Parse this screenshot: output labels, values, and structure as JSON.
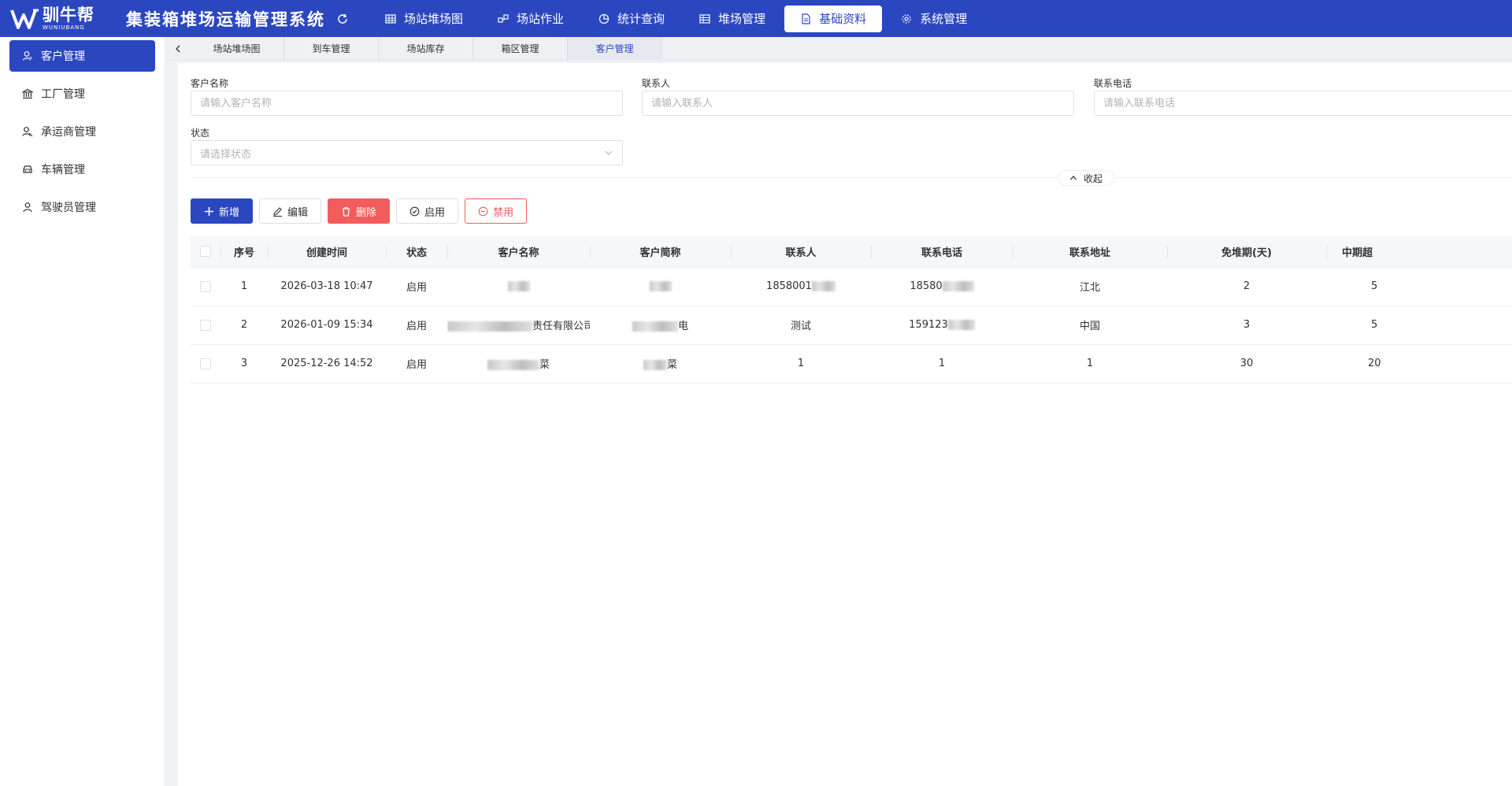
{
  "brand": {
    "logo_cn": "驯牛帮",
    "logo_en": "WUNIUBANG",
    "app_title": "集装箱堆场运输管理系统"
  },
  "nav": [
    {
      "label": "场站堆场图",
      "icon": "grid-icon",
      "active": false
    },
    {
      "label": "场站作业",
      "icon": "workflow-icon",
      "active": false
    },
    {
      "label": "统计查询",
      "icon": "pie-chart-icon",
      "active": false
    },
    {
      "label": "堆场管理",
      "icon": "table-icon",
      "active": false
    },
    {
      "label": "基础资料",
      "icon": "document-icon",
      "active": true
    },
    {
      "label": "系统管理",
      "icon": "gear-icon",
      "active": false
    }
  ],
  "sidebar": {
    "items": [
      {
        "label": "客户管理",
        "icon": "customer-icon",
        "active": true
      },
      {
        "label": "工厂管理",
        "icon": "factory-icon",
        "active": false
      },
      {
        "label": "承运商管理",
        "icon": "carrier-icon",
        "active": false
      },
      {
        "label": "车辆管理",
        "icon": "car-icon",
        "active": false
      },
      {
        "label": "驾驶员管理",
        "icon": "driver-icon",
        "active": false
      }
    ]
  },
  "tabs": [
    {
      "label": "场站堆场图",
      "active": false
    },
    {
      "label": "到车管理",
      "active": false
    },
    {
      "label": "场站库存",
      "active": false
    },
    {
      "label": "箱区管理",
      "active": false
    },
    {
      "label": "客户管理",
      "active": true
    }
  ],
  "filters": {
    "customer_name": {
      "label": "客户名称",
      "placeholder": "请输入客户名称"
    },
    "contact": {
      "label": "联系人",
      "placeholder": "请输入联系人"
    },
    "phone": {
      "label": "联系电话",
      "placeholder": "请输入联系电话"
    },
    "status": {
      "label": "状态",
      "placeholder": "请选择状态"
    },
    "collapse_label": "收起"
  },
  "toolbar": {
    "add": "新增",
    "edit": "编辑",
    "delete": "删除",
    "enable": "启用",
    "disable": "禁用"
  },
  "table": {
    "columns": [
      "序号",
      "创建时间",
      "状态",
      "客户名称",
      "客户简称",
      "联系人",
      "联系电话",
      "联系地址",
      "免堆期(天)",
      "中期超"
    ],
    "rows": [
      {
        "index": "1",
        "created": "2026-03-18 10:47",
        "status": "启用",
        "name_visible": "",
        "short_visible": "",
        "contact_visible": "1858001",
        "phone_visible": "18580",
        "address": "江北",
        "free_days": "2",
        "mid": "5"
      },
      {
        "index": "2",
        "created": "2026-01-09 15:34",
        "status": "启用",
        "name_visible": "责任有限公司",
        "short_visible": "电",
        "contact_visible": "测试",
        "phone_visible": "159123",
        "address": "中国",
        "free_days": "3",
        "mid": "5"
      },
      {
        "index": "3",
        "created": "2025-12-26 14:52",
        "status": "启用",
        "name_visible": "菜",
        "short_visible": "菜",
        "contact_visible": "1",
        "phone_visible": "1",
        "address": "1",
        "free_days": "30",
        "mid": "20"
      }
    ]
  },
  "colors": {
    "primary": "#2b47c0",
    "danger": "#f25c5c"
  }
}
